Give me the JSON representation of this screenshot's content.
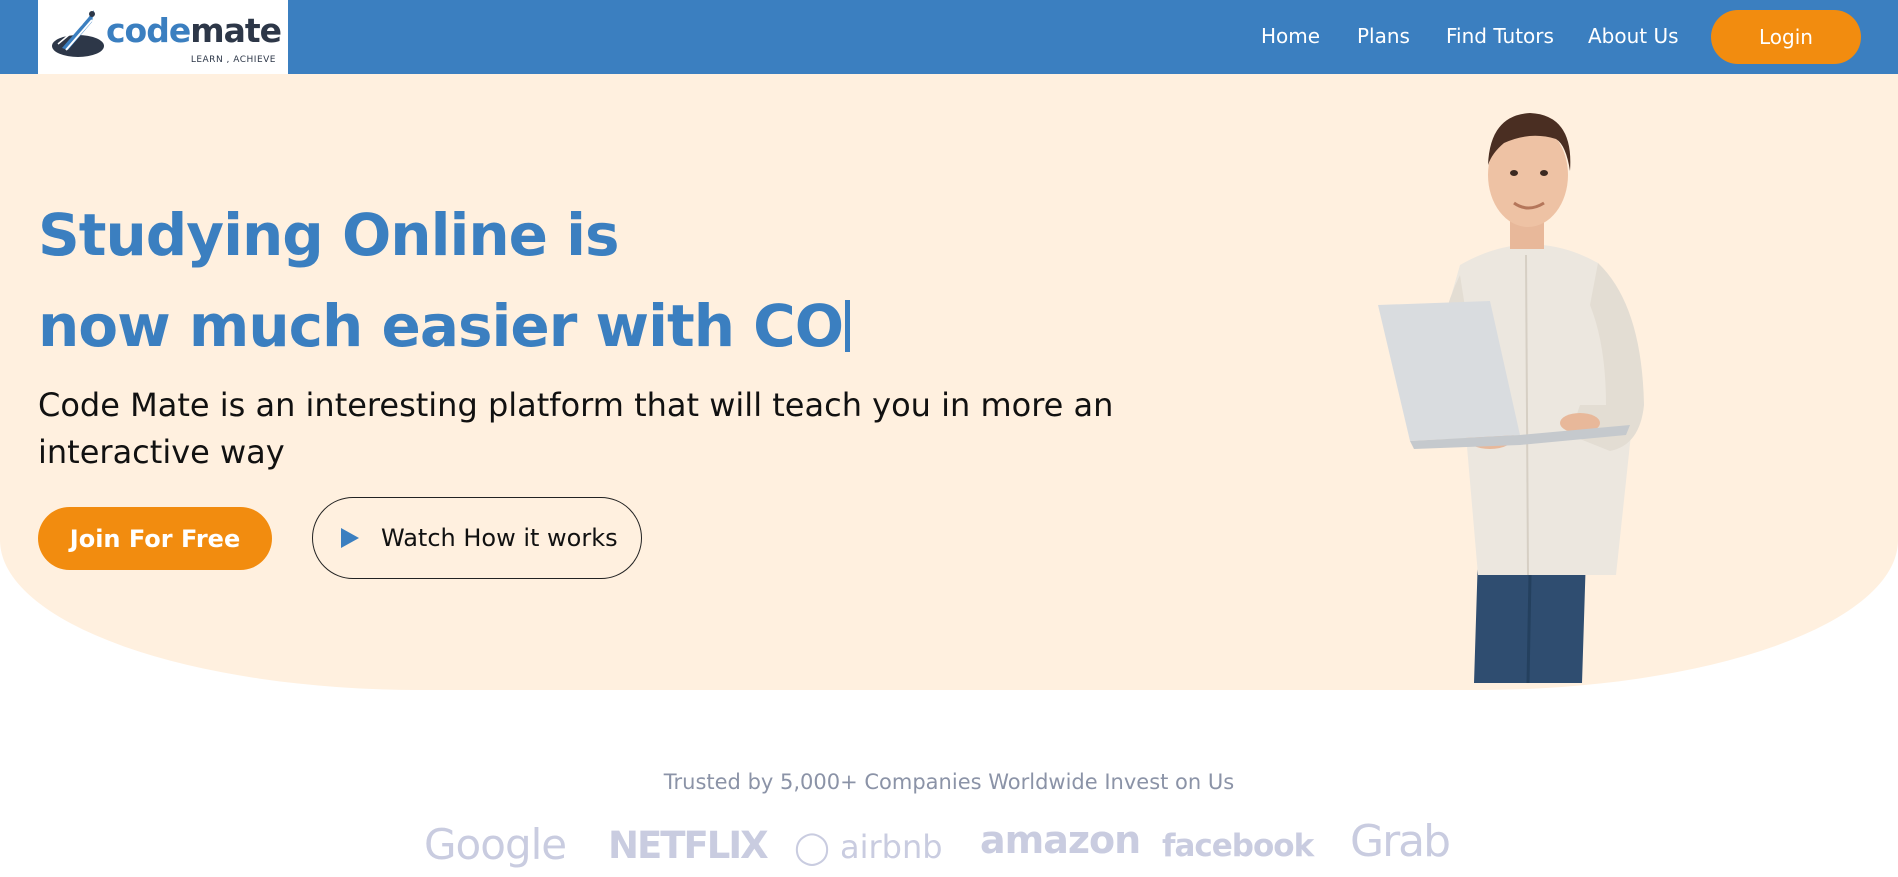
{
  "brand": {
    "name_part1": "code",
    "name_part2": "mate",
    "tagline": "LEARN , ACHIEVE",
    "logo_icon": "rocket-icon"
  },
  "nav": {
    "links": [
      "Home",
      "Plans",
      "Find Tutors",
      "About Us"
    ],
    "login_label": "Login"
  },
  "hero": {
    "title_line1": "Studying Online is",
    "title_line2": "now much easier with CO",
    "subtitle": "Code Mate is an interesting platform that will teach you in more an interactive way",
    "join_label": "Join For Free",
    "watch_label": "Watch How it works",
    "watch_icon": "play-icon"
  },
  "trusted": {
    "text": "Trusted by 5,000+ Companies Worldwide Invest on Us",
    "logos": [
      "Google",
      "NETFLIX",
      "airbnb",
      "amazon",
      "facebook",
      "Grab"
    ]
  },
  "colors": {
    "primary_blue": "#3b7fc0",
    "accent_orange": "#f28c0f",
    "hero_bg": "#fff0df",
    "logo_grey": "#c9cce0"
  }
}
